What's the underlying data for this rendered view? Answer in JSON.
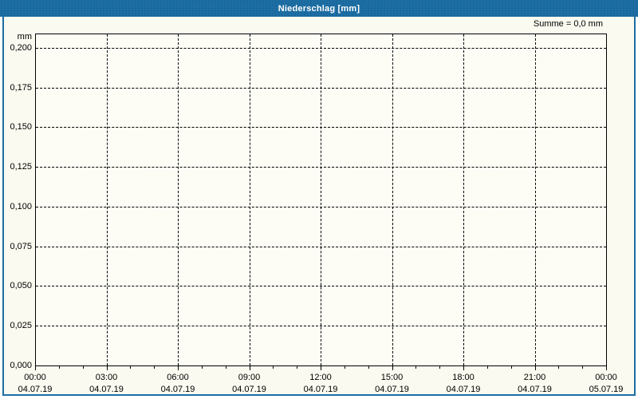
{
  "window": {
    "title": "Niederschlag [mm]"
  },
  "summary_label": "Summe = 0,0 mm",
  "colors": {
    "titlebar": "#1c6ea4",
    "border": "#1c6ea4",
    "panel_bg": "#fafaf0",
    "plot_bg": "#fdfdf6",
    "grid": "#000000",
    "title_text": "#ffffff",
    "text": "#000000"
  },
  "chart_data": {
    "type": "bar",
    "title": "Niederschlag [mm]",
    "ylabel": "mm",
    "summary": "Summe = 0,0 mm",
    "ylim": [
      0,
      0.209
    ],
    "y_tick_step": 0.025,
    "grid": "dashed",
    "legend": "none",
    "y_ticks": [
      {
        "value": 0.2,
        "label": "0,200"
      },
      {
        "value": 0.175,
        "label": "0,175"
      },
      {
        "value": 0.15,
        "label": "0,150"
      },
      {
        "value": 0.125,
        "label": "0,125"
      },
      {
        "value": 0.1,
        "label": "0,100"
      },
      {
        "value": 0.075,
        "label": "0,075"
      },
      {
        "value": 0.05,
        "label": "0,050"
      },
      {
        "value": 0.025,
        "label": "0,025"
      },
      {
        "value": 0.0,
        "label": "0,000"
      }
    ],
    "x_ticks": [
      {
        "time": "00:00",
        "date": "04.07.19"
      },
      {
        "time": "03:00",
        "date": "04.07.19"
      },
      {
        "time": "06:00",
        "date": "04.07.19"
      },
      {
        "time": "09:00",
        "date": "04.07.19"
      },
      {
        "time": "12:00",
        "date": "04.07.19"
      },
      {
        "time": "15:00",
        "date": "04.07.19"
      },
      {
        "time": "18:00",
        "date": "04.07.19"
      },
      {
        "time": "21:00",
        "date": "04.07.19"
      },
      {
        "time": "00:00",
        "date": "05.07.19"
      }
    ],
    "x_minor_ticks_per_interval": 2,
    "series": [
      {
        "name": "Niederschlag",
        "values": [],
        "sum_mm": 0.0
      }
    ]
  }
}
